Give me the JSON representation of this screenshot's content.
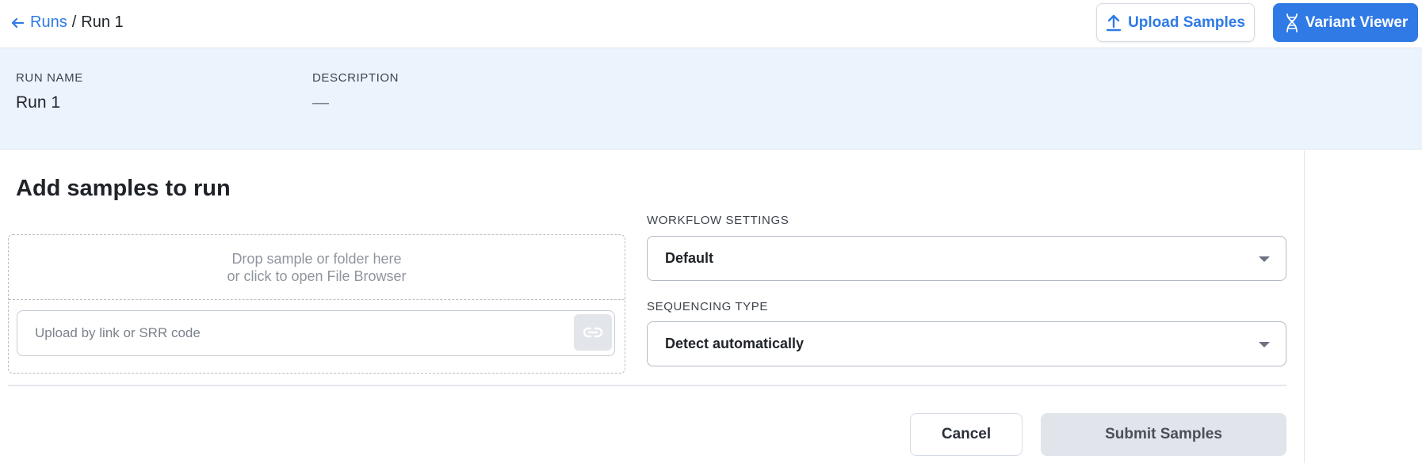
{
  "breadcrumb": {
    "back_label": "Runs",
    "separator": "/",
    "current": "Run 1"
  },
  "header": {
    "upload_label": "Upload Samples",
    "variant_label": "Variant Viewer"
  },
  "run_info": {
    "run_name_label": "RUN NAME",
    "run_name_value": "Run 1",
    "description_label": "DESCRIPTION",
    "description_value": "—"
  },
  "panel": {
    "title": "Add samples to run",
    "dropzone_text": "Drop sample or folder here or click to open File Browser",
    "link_placeholder": "Upload by link or SRR code",
    "link_value": ""
  },
  "workflow": {
    "label": "WORKFLOW SETTINGS",
    "selected": "Default"
  },
  "sequencing": {
    "label": "SEQUENCING TYPE",
    "selected": "Detect automatically"
  },
  "actions": {
    "cancel_label": "Cancel",
    "submit_label": "Submit Samples"
  },
  "colors": {
    "accent": "#2f7ae5",
    "info_band": "#ebf3fd",
    "submit_disabled": "#e1e4ea"
  },
  "icons": {
    "back": "arrow-left-icon",
    "upload": "upload-icon",
    "variant": "dna-icon",
    "link": "link-icon",
    "dropdown": "caret-down-icon"
  }
}
